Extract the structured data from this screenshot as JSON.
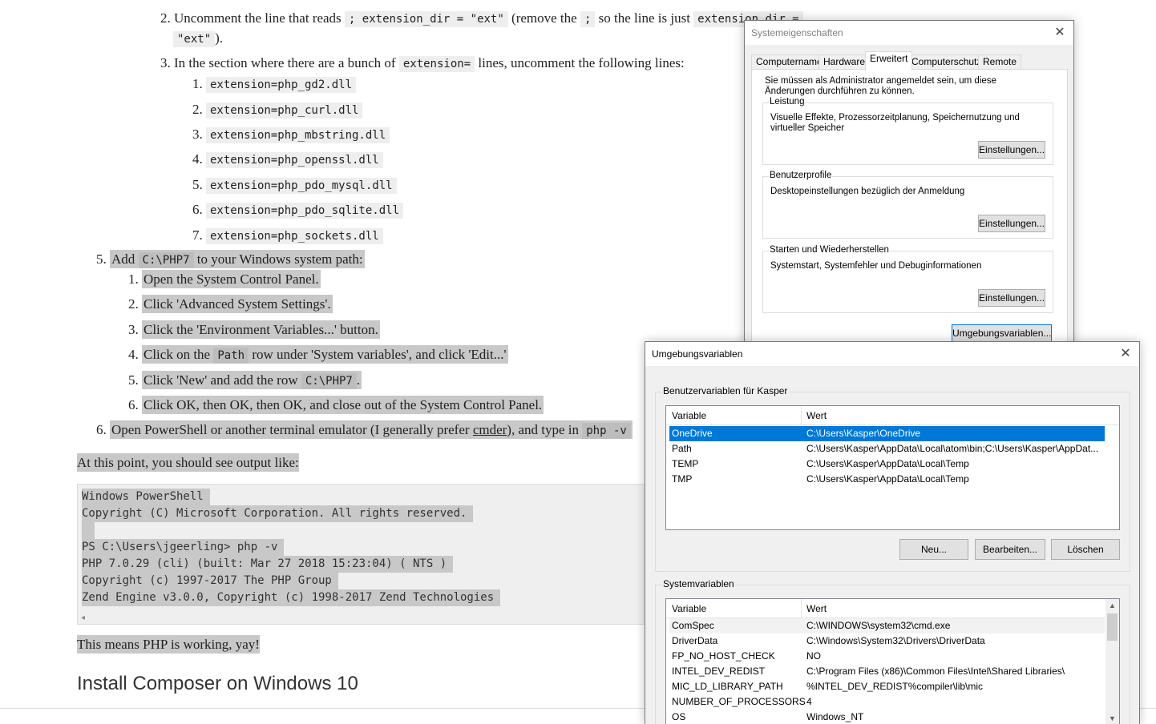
{
  "article": {
    "step2": {
      "num": "2.",
      "t1": "Uncomment the line that reads",
      "c1": "; extension_dir = \"ext\"",
      "t2": "(remove the",
      "c2": ";",
      "t3": "so the line is just",
      "c3": "extension_dir =",
      "c4": "\"ext\"",
      "t4": ")."
    },
    "step3": {
      "num": "3.",
      "t1": "In the section where there are a bunch of",
      "c1": "extension=",
      "t2": "lines, uncomment the following lines:"
    },
    "extensions": [
      {
        "num": "1.",
        "code": "extension=php_gd2.dll"
      },
      {
        "num": "2.",
        "code": "extension=php_curl.dll"
      },
      {
        "num": "3.",
        "code": "extension=php_mbstring.dll"
      },
      {
        "num": "4.",
        "code": "extension=php_openssl.dll"
      },
      {
        "num": "5.",
        "code": "extension=php_pdo_mysql.dll"
      },
      {
        "num": "6.",
        "code": "extension=php_pdo_sqlite.dll"
      },
      {
        "num": "7.",
        "code": "extension=php_sockets.dll"
      }
    ],
    "step5": {
      "num": "5.",
      "t1": "Add",
      "c1": "C:\\PHP7",
      "t2": "to your Windows system path:"
    },
    "substeps": [
      {
        "num": "1.",
        "text": "Open the System Control Panel."
      },
      {
        "num": "2.",
        "text": "Click 'Advanced System Settings'."
      },
      {
        "num": "3.",
        "text": "Click the 'Environment Variables...' button."
      },
      {
        "num": "4.",
        "t1": "Click on the",
        "code": "Path",
        "t2": "row under 'System variables', and click 'Edit...'"
      },
      {
        "num": "5.",
        "t1": "Click 'New' and add the row",
        "code": "C:\\PHP7",
        "t2": "."
      },
      {
        "num": "6.",
        "text": "Click OK, then OK, then OK, and close out of the System Control Panel."
      }
    ],
    "step6": {
      "num": "6.",
      "t1": "Open PowerShell or another terminal emulator (I generally prefer",
      "link": "cmder",
      "t2": "), and type in",
      "code": "php -v"
    },
    "output_intro": "At this point, you should see output like:",
    "pre_lines": [
      "Windows PowerShell",
      "Copyright (C) Microsoft Corporation. All rights reserved.",
      " ",
      "PS C:\\Users\\jgeerling> php -v",
      "PHP 7.0.29 (cli) (built: Mar 27 2018 15:23:04) ( NTS )",
      "Copyright (c) 1997-2017 The PHP Group",
      "Zend Engine v3.0.0, Copyright (c) 1998-2017 Zend Technologies"
    ],
    "working": "This means PHP is working, yay!",
    "heading": "Install Composer on Windows 10"
  },
  "sysprops": {
    "title": "Systemeigenschaften",
    "tabs": [
      "Computername",
      "Hardware",
      "Erweitert",
      "Computerschutz",
      "Remote"
    ],
    "active_tab": "Erweitert",
    "admin_note": "Sie müssen als Administrator angemeldet sein, um diese Änderungen durchführen zu können.",
    "groups": [
      {
        "title": "Leistung",
        "desc": "Visuelle Effekte, Prozessorzeitplanung, Speichernutzung und virtueller Speicher",
        "button": "Einstellungen..."
      },
      {
        "title": "Benutzerprofile",
        "desc": "Desktopeinstellungen bezüglich der Anmeldung",
        "button": "Einstellungen..."
      },
      {
        "title": "Starten und Wiederherstellen",
        "desc": "Systemstart, Systemfehler und Debuginformationen",
        "button": "Einstellungen..."
      }
    ],
    "env_button": "Umgebungsvariablen..."
  },
  "envvars": {
    "title": "Umgebungsvariablen",
    "user_group": "Benutzervariablen für Kasper",
    "col_variable": "Variable",
    "col_value": "Wert",
    "user_rows": [
      {
        "name": "OneDrive",
        "value": "C:\\Users\\Kasper\\OneDrive"
      },
      {
        "name": "Path",
        "value": "C:\\Users\\Kasper\\AppData\\Local\\atom\\bin;C:\\Users\\Kasper\\AppDat..."
      },
      {
        "name": "TEMP",
        "value": "C:\\Users\\Kasper\\AppData\\Local\\Temp"
      },
      {
        "name": "TMP",
        "value": "C:\\Users\\Kasper\\AppData\\Local\\Temp"
      }
    ],
    "user_buttons": {
      "new": "Neu...",
      "edit": "Bearbeiten...",
      "delete": "Löschen"
    },
    "system_group": "Systemvariablen",
    "system_rows": [
      {
        "name": "ComSpec",
        "value": "C:\\WINDOWS\\system32\\cmd.exe"
      },
      {
        "name": "DriverData",
        "value": "C:\\Windows\\System32\\Drivers\\DriverData"
      },
      {
        "name": "FP_NO_HOST_CHECK",
        "value": "NO"
      },
      {
        "name": "INTEL_DEV_REDIST",
        "value": "C:\\Program Files (x86)\\Common Files\\Intel\\Shared Libraries\\"
      },
      {
        "name": "MIC_LD_LIBRARY_PATH",
        "value": "%INTEL_DEV_REDIST%compiler\\lib\\mic"
      },
      {
        "name": "NUMBER_OF_PROCESSORS",
        "value": "4"
      },
      {
        "name": "OS",
        "value": "Windows_NT"
      }
    ],
    "close_glyph": "✕"
  }
}
